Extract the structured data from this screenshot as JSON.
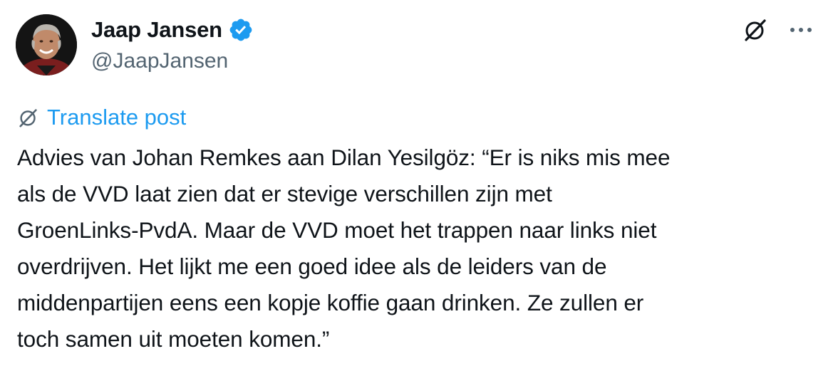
{
  "author": {
    "display_name": "Jaap Jansen",
    "handle": "@JaapJansen",
    "verified": true
  },
  "actions": {
    "grok_icon": "grok-icon",
    "more_icon": "more-horizontal-icon"
  },
  "translate": {
    "label": "Translate post",
    "icon": "grok-icon"
  },
  "post": {
    "text": "Advies van Johan Remkes aan Dilan Yesilgöz: “Er is niks mis mee\nals de VVD laat zien dat er stevige verschillen zijn met\nGroenLinks-PvdA. Maar de VVD moet het trappen naar links niet\noverdrijven. Het lijkt me een goed idee als de leiders van de\nmiddenpartijen eens een kopje koffie gaan drinken. Ze zullen er\ntoch samen uit moeten komen.”"
  },
  "colors": {
    "text": "#0f1419",
    "secondary": "#536471",
    "link": "#1d9bf0",
    "verified": "#1d9bf0"
  }
}
